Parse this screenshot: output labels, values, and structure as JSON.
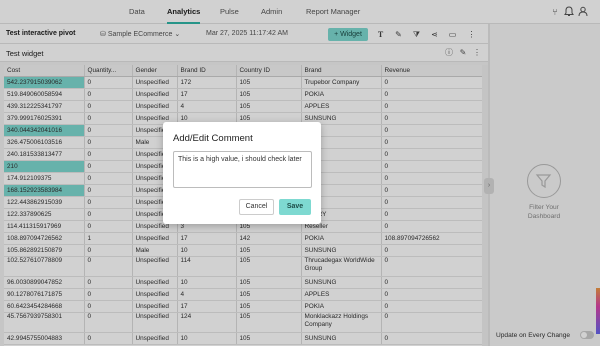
{
  "nav": {
    "tabs": [
      "Data",
      "Analytics",
      "Pulse",
      "Admin",
      "Report Manager"
    ],
    "active": "Analytics"
  },
  "toolbar": {
    "title": "Test interactive pivot",
    "datasource": "Sample ECommerce",
    "timestamp": "Mar 27, 2025 11:17:42 AM",
    "widget_label": "+ Widget"
  },
  "widget": {
    "title": "Test widget"
  },
  "table": {
    "columns": [
      "Cost",
      "Quantity...",
      "Gender",
      "Brand ID",
      "Country ID",
      "Brand",
      "Revenue"
    ],
    "rows": [
      [
        "542.237915039062",
        "0",
        "Unspecified",
        "172",
        "105",
        "Trupebor Company",
        "0"
      ],
      [
        "519.849060058594",
        "0",
        "Unspecified",
        "17",
        "105",
        "POKIA",
        "0"
      ],
      [
        "439.312225341797",
        "0",
        "Unspecified",
        "4",
        "105",
        "APPLES",
        "0"
      ],
      [
        "379.999176025391",
        "0",
        "Unspecified",
        "10",
        "105",
        "SUNSUNG",
        "0"
      ],
      [
        "340.044342041016",
        "0",
        "Unspecified",
        "10",
        "105",
        "",
        "0"
      ],
      [
        "326.475006103516",
        "0",
        "Male",
        "",
        "",
        "",
        "0"
      ],
      [
        "240.181533813477",
        "0",
        "Unspecified",
        "",
        "",
        "",
        "0"
      ],
      [
        "210",
        "0",
        "Unspecified",
        "",
        "",
        "",
        "0"
      ],
      [
        "174.912109375",
        "0",
        "Unspecified",
        "",
        "",
        "",
        "0"
      ],
      [
        "168.152923583984",
        "0",
        "Unspecified",
        "",
        "",
        "",
        "0"
      ],
      [
        "122.443862915039",
        "0",
        "Unspecified",
        "",
        "",
        "",
        "0"
      ],
      [
        "122.337890625",
        "0",
        "Unspecified",
        "",
        "",
        "BERRY",
        "0"
      ],
      [
        "114.411315917969",
        "0",
        "Unspecified",
        "3",
        "105",
        "Reseller",
        "0"
      ],
      [
        "108.897094726562",
        "1",
        "Unspecified",
        "17",
        "142",
        "POKIA",
        "108.897094726562"
      ],
      [
        "105.862892150879",
        "0",
        "Male",
        "10",
        "105",
        "SUNSUNG",
        "0"
      ],
      [
        "102.527610778809",
        "0",
        "Unspecified",
        "114",
        "105",
        "Thrucadegax WorldWide Group",
        "0"
      ],
      [
        "96.0030899047852",
        "0",
        "Unspecified",
        "10",
        "105",
        "SUNSUNG",
        "0"
      ],
      [
        "90.1278076171875",
        "0",
        "Unspecified",
        "4",
        "105",
        "APPLES",
        "0"
      ],
      [
        "60.6423454284668",
        "0",
        "Unspecified",
        "17",
        "105",
        "POKIA",
        "0"
      ],
      [
        "45.7567939758301",
        "0",
        "Unspecified",
        "124",
        "105",
        "Monklackazz Holdings Company",
        "0"
      ],
      [
        "42.9945755004883",
        "0",
        "Unspecified",
        "10",
        "105",
        "SUNSUNG",
        "0"
      ]
    ],
    "highlighted_rows": [
      0,
      4,
      7,
      9
    ]
  },
  "right_panel": {
    "filter_text": "Filter Your Dashboard",
    "update_label": "Update on Every Change"
  },
  "modal": {
    "title": "Add/Edit Comment",
    "comment": "This is a high value, i should check later",
    "cancel_label": "Cancel",
    "save_label": "Save"
  },
  "colors": {
    "accent": "#7ed9d1",
    "active_tab": "#2fb5a7"
  }
}
